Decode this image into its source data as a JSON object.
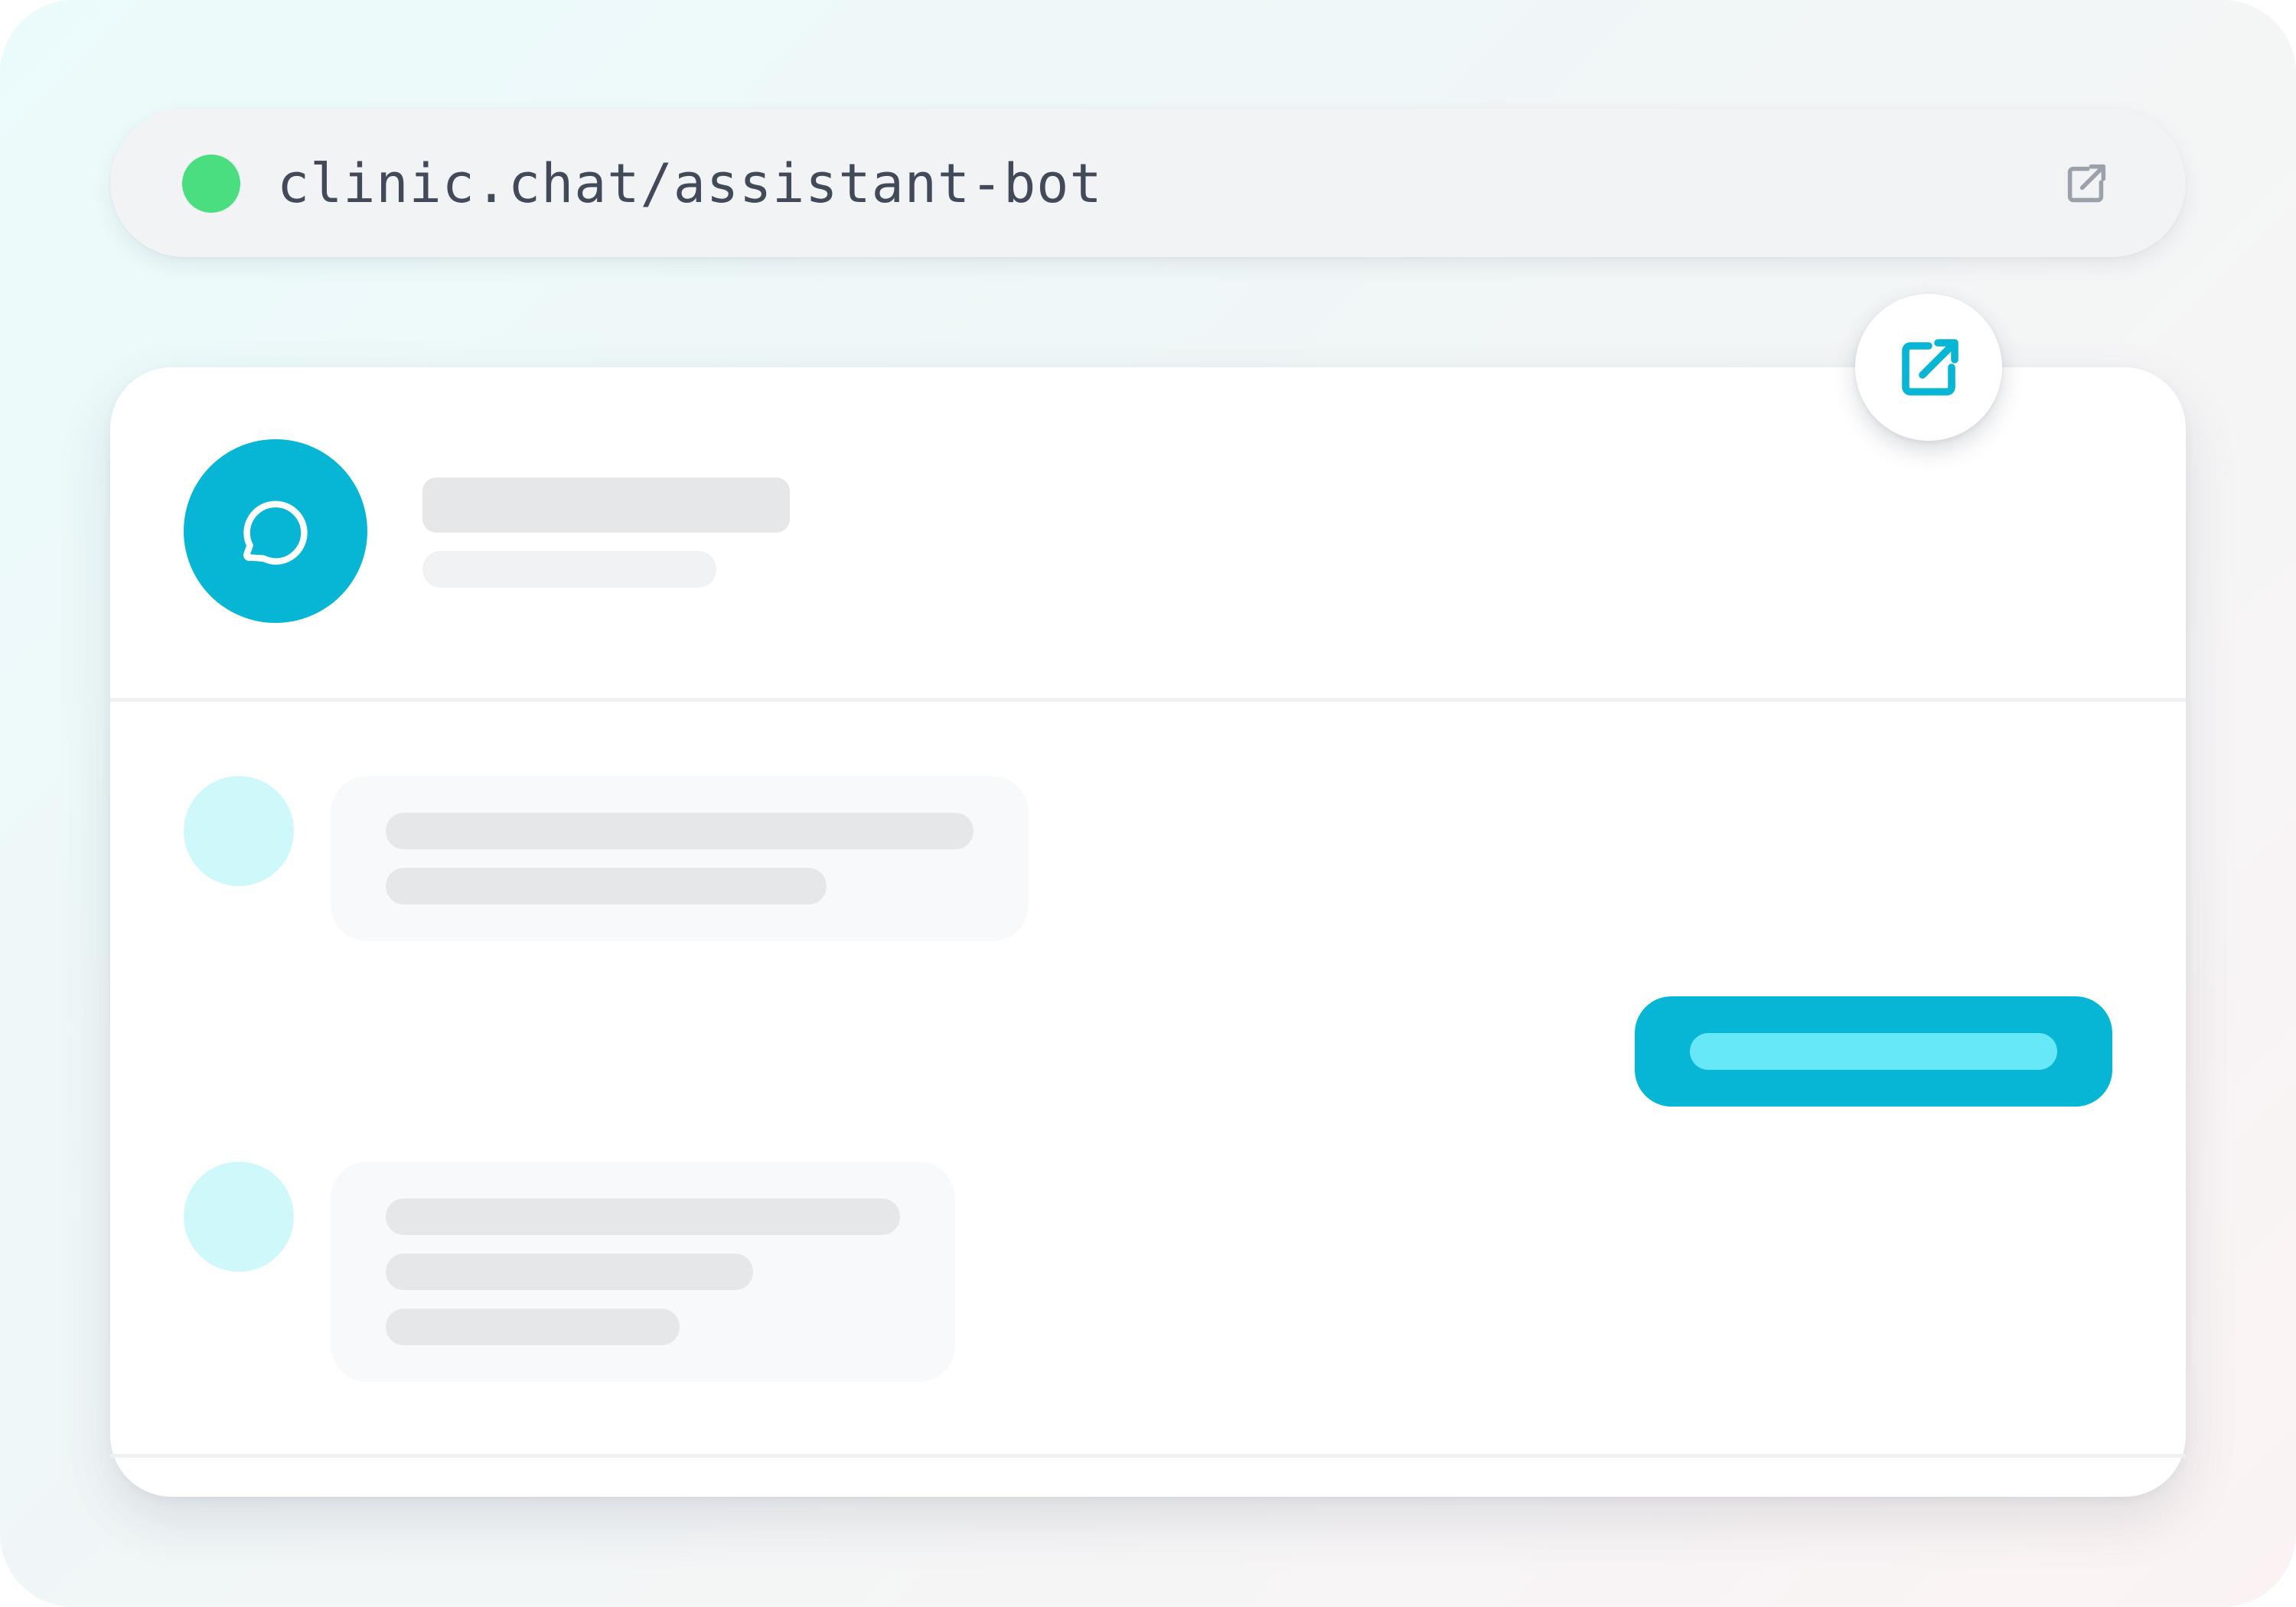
{
  "url_bar": {
    "url": "clinic.chat/assistant-bot",
    "status": "online",
    "status_color": "#4ade80",
    "action_icon": "external-link-icon"
  },
  "popout_button": {
    "icon": "external-link-icon",
    "color": "#06b6d4"
  },
  "chat_header": {
    "avatar_icon": "chat-bubble-icon",
    "avatar_color": "#06b6d4",
    "title": "",
    "subtitle": ""
  },
  "messages": [
    {
      "sender": "bot",
      "text": "",
      "placeholder_lines": 2
    },
    {
      "sender": "user",
      "text": "",
      "placeholder_lines": 1
    },
    {
      "sender": "bot",
      "text": "",
      "placeholder_lines": 3
    }
  ],
  "colors": {
    "accent": "#06b6d4",
    "accent_light": "#67e8f9",
    "bot_avatar": "#cff8fb",
    "skeleton": "#e6e7e9",
    "url_text": "#424a5a"
  }
}
